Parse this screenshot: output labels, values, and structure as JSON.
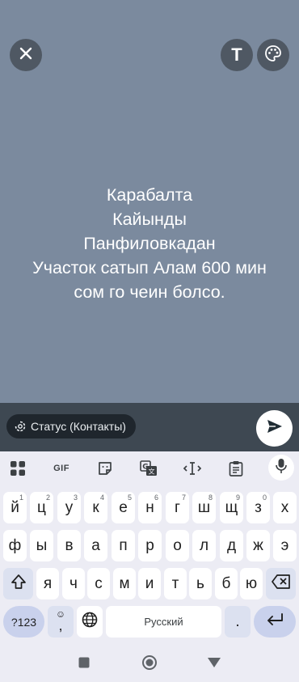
{
  "status_editor": {
    "text_lines": [
      "Карабалта",
      "Кайынды",
      "Панфиловкадан",
      "Участок сатып Алам 600 мин",
      "сом го чеин болсо."
    ],
    "background_color": "#7b8a9e",
    "audience_label": "Статус (Контакты)",
    "close_icon": "close-icon",
    "text_tool_label": "T",
    "palette_icon": "palette-icon",
    "send_icon": "send-icon"
  },
  "keyboard": {
    "toolbar": {
      "gif_label": "GIF",
      "icons": [
        "apps-grid-icon",
        "gif",
        "sticker-icon",
        "translate-icon",
        "text-cursor-icon",
        "clipboard-icon",
        "mic-icon"
      ]
    },
    "row1": [
      {
        "label": "й",
        "hint": "1"
      },
      {
        "label": "ц",
        "hint": "2"
      },
      {
        "label": "у",
        "hint": "3"
      },
      {
        "label": "к",
        "hint": "4"
      },
      {
        "label": "е",
        "hint": "5"
      },
      {
        "label": "н",
        "hint": "6"
      },
      {
        "label": "г",
        "hint": "7"
      },
      {
        "label": "ш",
        "hint": "8"
      },
      {
        "label": "щ",
        "hint": "9"
      },
      {
        "label": "з",
        "hint": "0"
      },
      {
        "label": "х",
        "hint": ""
      }
    ],
    "row2": [
      "ф",
      "ы",
      "в",
      "а",
      "п",
      "р",
      "о",
      "л",
      "д",
      "ж",
      "э"
    ],
    "row3": [
      "я",
      "ч",
      "с",
      "м",
      "и",
      "т",
      "ь",
      "б",
      "ю"
    ],
    "symbols_label": "?123",
    "comma_label": ",",
    "comma_hint": "☺",
    "space_label": "Русский",
    "period_label": "."
  }
}
